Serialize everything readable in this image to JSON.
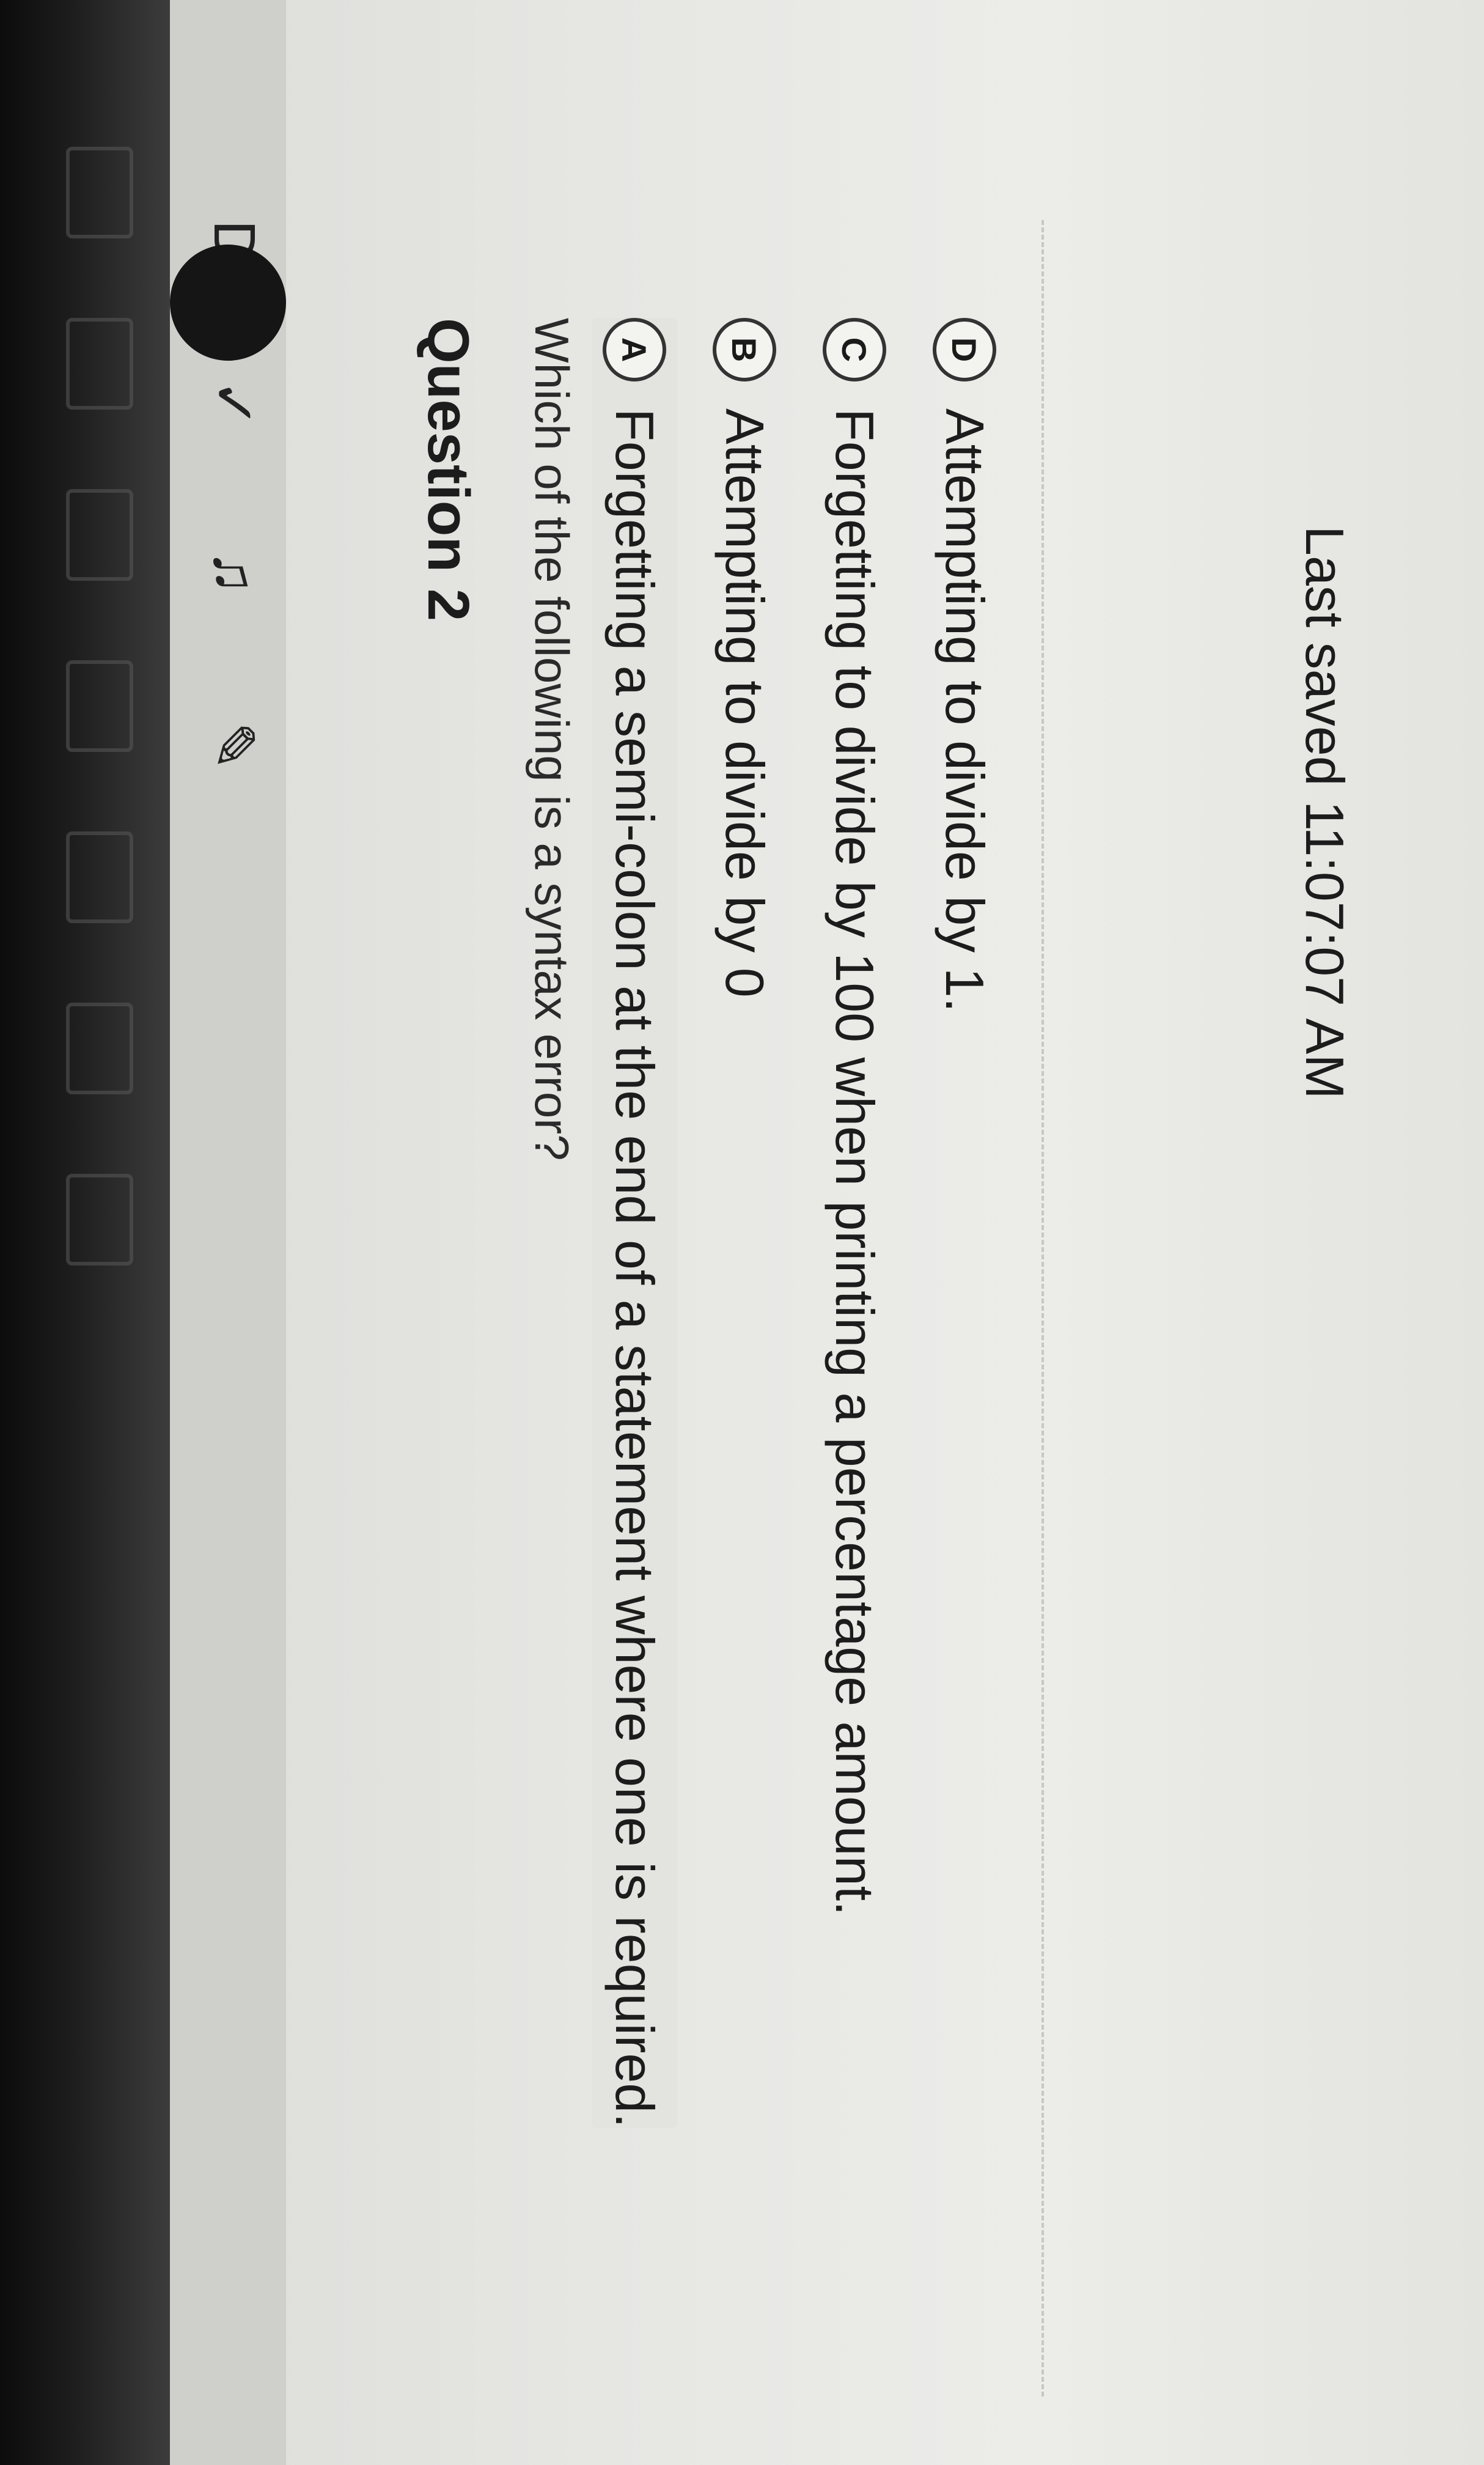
{
  "question": {
    "title": "Question 2",
    "prompt": "Which of the following is a syntax error?",
    "choices": [
      {
        "letter": "A",
        "text": "Forgetting a semi-colon at the end of a statement where one is required."
      },
      {
        "letter": "B",
        "text": "Attempting to divide by 0"
      },
      {
        "letter": "C",
        "text": "Forgetting to divide by 100 when printing a percentage amount."
      },
      {
        "letter": "D",
        "text": "Attempting to divide by 1."
      }
    ]
  },
  "status": {
    "last_saved": "Last saved 11:07:07 AM"
  },
  "tool_rail": {
    "letter": "D"
  },
  "icons": [
    "pencil-icon",
    "check-icon",
    "speaker-icon",
    "dictionary-icon",
    "calculator-icon",
    "globe-icon"
  ]
}
